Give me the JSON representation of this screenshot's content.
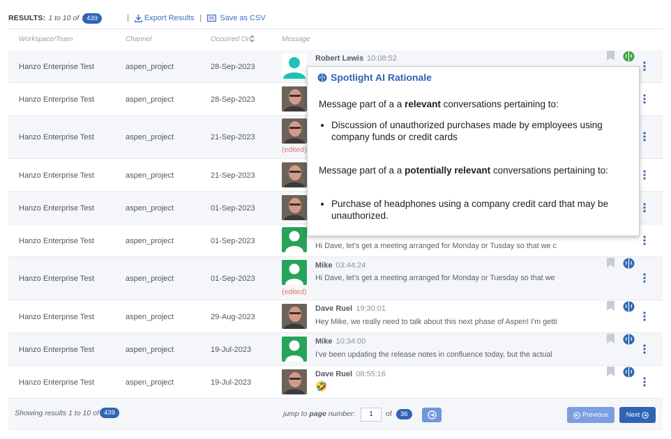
{
  "toolbar": {
    "results_label": "RESULTS:",
    "results_range": "1 to 10 of",
    "total": "439",
    "separator": "|",
    "export_label": "Export Results",
    "csv_label": "Save as CSV"
  },
  "columns": [
    "Workspace/Team",
    "Channel",
    "Occurred On",
    "Message"
  ],
  "rows": [
    {
      "workspace": "Hanzo Enterprise Test",
      "channel": "aspen_project",
      "date": "28-Sep-2023",
      "author": "Robert Lewis",
      "time": "10:08:52",
      "message": "",
      "edited": "",
      "avatar": "teal-person"
    },
    {
      "workspace": "Hanzo Enterprise Test",
      "channel": "aspen_project",
      "date": "28-Sep-2023",
      "author": "",
      "time": "",
      "message": "",
      "edited": "",
      "avatar": "photo"
    },
    {
      "workspace": "Hanzo Enterprise Test",
      "channel": "aspen_project",
      "date": "21-Sep-2023",
      "author": "",
      "time": "",
      "message": "",
      "edited": "(edited)",
      "avatar": "photo"
    },
    {
      "workspace": "Hanzo Enterprise Test",
      "channel": "aspen_project",
      "date": "21-Sep-2023",
      "author": "",
      "time": "",
      "message": "",
      "edited": "",
      "avatar": "photo"
    },
    {
      "workspace": "Hanzo Enterprise Test",
      "channel": "aspen_project",
      "date": "01-Sep-2023",
      "author": "",
      "time": "",
      "message": "",
      "edited": "",
      "avatar": "photo"
    },
    {
      "workspace": "Hanzo Enterprise Test",
      "channel": "aspen_project",
      "date": "01-Sep-2023",
      "author": "",
      "time": "",
      "message": "Hi Dave, let's get a meeting arranged for Monday or Tusday so that we c",
      "edited": "",
      "avatar": "green-person"
    },
    {
      "workspace": "Hanzo Enterprise Test",
      "channel": "aspen_project",
      "date": "01-Sep-2023",
      "author": "Mike",
      "time": "03:44:24",
      "message": "Hi Dave, let's get a meeting arranged for Monday or Tuesday so that we",
      "edited": "(edited)",
      "avatar": "green-person"
    },
    {
      "workspace": "Hanzo Enterprise Test",
      "channel": "aspen_project",
      "date": "29-Aug-2023",
      "author": "Dave Ruel",
      "time": "19:30:01",
      "message": "Hey Mike, we really need to talk about this next phase of Aspen! I'm getti",
      "edited": "",
      "avatar": "photo"
    },
    {
      "workspace": "Hanzo Enterprise Test",
      "channel": "aspen_project",
      "date": "19-Jul-2023",
      "author": "Mike",
      "time": "10:34:00",
      "message": "I've been updating the release notes in confluence today, but the actual",
      "edited": "",
      "avatar": "green-person"
    },
    {
      "workspace": "Hanzo Enterprise Test",
      "channel": "aspen_project",
      "date": "19-Jul-2023",
      "author": "Dave Ruel",
      "time": "08:55:16",
      "message": "🤣",
      "edited": "",
      "avatar": "photo"
    }
  ],
  "popup": {
    "title": "Spotlight AI Rationale",
    "p1_prefix": "Message part of a a ",
    "p1_bold": "relevant",
    "p1_suffix": " conversations pertaining to:",
    "bullet1": "Discussion of unauthorized purchases made by employees using company funds or credit cards",
    "p2_prefix": "Message part of a a ",
    "p2_bold": "potentially relevant",
    "p2_suffix": " conversations pertaining to:",
    "bullet2": "Purchase of headphones using a company credit card that may be unauthorized."
  },
  "footer": {
    "showing": "Showing results 1 to 10 of",
    "total": "439",
    "jump_prefix": "jump to ",
    "jump_bold": "page",
    "jump_suffix": " number:",
    "page_value": "1",
    "of_label": "of",
    "page_count": "36",
    "prev_label": "Previous",
    "next_label": "Next"
  },
  "colors": {
    "accent": "#2f64b4",
    "edited": "#e0736b",
    "avatar_green": "#27a35a",
    "avatar_teal": "#1fc2b4"
  }
}
